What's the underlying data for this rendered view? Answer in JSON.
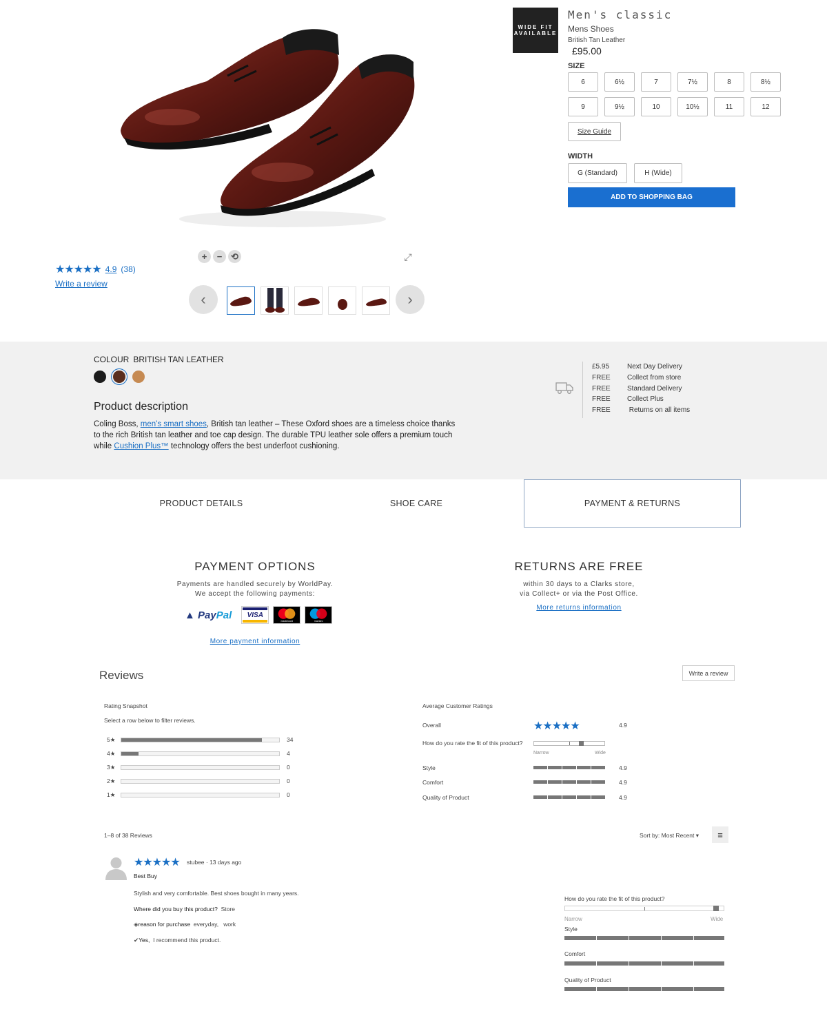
{
  "product": {
    "badge_line1": "WIDE FIT",
    "badge_line2": "AVAILABLE",
    "title": "Men's classic",
    "category": "Mens Shoes",
    "colour_name": "British Tan Leather",
    "price": "£95.00"
  },
  "size": {
    "label": "SIZE",
    "options": [
      "6",
      "6½",
      "7",
      "7½",
      "8",
      "8½",
      "9",
      "9½",
      "10",
      "10½",
      "11",
      "12"
    ],
    "guide_label": "Size Guide"
  },
  "width": {
    "label": "WIDTH",
    "options": [
      "G (Standard)",
      "H (Wide)"
    ]
  },
  "cta": {
    "add_to_bag": "ADD TO SHOPPING BAG"
  },
  "rating_summary": {
    "stars": "★★★★★",
    "score": "4.9",
    "count": "(38)",
    "write_review": "Write a review"
  },
  "gallery": {
    "zoom_in": "+",
    "zoom_out": "−",
    "reset": "⟲",
    "expand": "⤢",
    "prev": "‹",
    "next": "›"
  },
  "colour": {
    "label": "COLOUR",
    "selected": "BRITISH TAN LEATHER",
    "swatches": [
      "#1c1c1c",
      "#5a2e1e",
      "#c68a52"
    ]
  },
  "description": {
    "title": "Product description",
    "text_1": "Coling Boss, ",
    "link_1": "men's smart shoes",
    "text_2": ", British tan leather – These Oxford shoes are a timeless choice thanks to the rich British tan leather and toe cap design. The durable TPU leather sole offers a premium touch while ",
    "link_2": "Cushion Plus™",
    "text_3": " technology offers the best underfoot cushioning."
  },
  "delivery": [
    {
      "price": "£5.95",
      "label": "Next Day Delivery"
    },
    {
      "price": "FREE",
      "label": "Collect from store"
    },
    {
      "price": "FREE",
      "label": "Standard Delivery"
    },
    {
      "price": "FREE",
      "label": "Collect Plus"
    },
    {
      "price": "FREE",
      "label": " Returns on all items"
    }
  ],
  "tabs": [
    "PRODUCT DETAILS",
    "SHOE CARE",
    "PAYMENT & RETURNS"
  ],
  "payment": {
    "title": "PAYMENT OPTIONS",
    "line1": "Payments are handled securely by WorldPay.",
    "line2": "We accept the following payments:",
    "paypal_a": "Pay",
    "paypal_b": "Pal",
    "visa": "VISA",
    "mastercard": "mastercard",
    "maestro": "maestro",
    "more": "More payment information"
  },
  "returns": {
    "title": "RETURNS ARE FREE",
    "line1": "within 30 days to a Clarks store,",
    "line2": "via Collect+ or via the Post Office.",
    "more": "More returns information"
  },
  "reviews": {
    "title": "Reviews",
    "write_review": "Write a review",
    "snapshot_title": "Rating Snapshot",
    "snapshot_sub": "Select a row below to filter reviews.",
    "snapshot": [
      {
        "label": "5★",
        "count": 34,
        "fraction": 0.89
      },
      {
        "label": "4★",
        "count": 4,
        "fraction": 0.11
      },
      {
        "label": "3★",
        "count": 0,
        "fraction": 0
      },
      {
        "label": "2★",
        "count": 0,
        "fraction": 0
      },
      {
        "label": "1★",
        "count": 0,
        "fraction": 0
      }
    ],
    "avg_title": "Average Customer Ratings",
    "overall_label": "Overall",
    "overall_stars": "★★★★★",
    "overall_value": "4.9",
    "fit_question": "How do you rate the fit of this product?",
    "fit_position": 0.68,
    "narrow": "Narrow",
    "wide": "Wide",
    "attributes": [
      {
        "label": "Style",
        "value": "4.9"
      },
      {
        "label": "Comfort",
        "value": "4.9"
      },
      {
        "label": "Quality of Product",
        "value": "4.9"
      }
    ],
    "count_text": "1–8 of 38 Reviews",
    "sort_label": "Sort by: Most Recent",
    "menu_icon": "≡",
    "item": {
      "stars": "★★★★★",
      "meta": "stubee · 13 days ago",
      "headline": "Best Buy",
      "body": "Stylish and very comfortable. Best shoes bought in many years.",
      "q_label": "Where did you buy this product?",
      "q_answer": "Store",
      "reason_label": "reason for purchase",
      "reason_answer": "everyday,   work",
      "rec_yes": "Yes,",
      "rec_text": "I recommend this product.",
      "fit_question": "How do you rate the fit of this product?",
      "fit_position": 0.97,
      "narrow": "Narrow",
      "wide": "Wide",
      "style_label": "Style",
      "comfort_label": "Comfort",
      "quality_label": "Quality of Product"
    }
  }
}
